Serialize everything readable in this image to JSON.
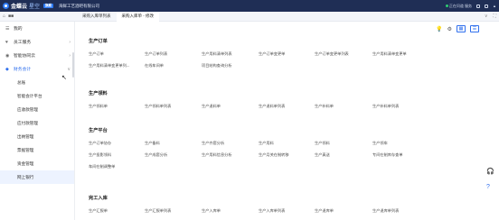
{
  "topbar": {
    "brand_main": "金蝶云",
    "brand_star": "星空",
    "badge": "旗舰",
    "company": "海鲜工艺酒吧有限公司",
    "right_status": "正在问道 服务",
    "right_extra": "▲"
  },
  "tabbar": {
    "icon_home": "⌂",
    "icon_grid": "■■",
    "tabs": [
      {
        "label": "采购入库单列表"
      },
      {
        "label": "采购入库单 - 修改"
      }
    ],
    "right_chevron": "∨",
    "right_expand": "⛶"
  },
  "sidebar": {
    "items": [
      {
        "label": "我的",
        "icon": "☰",
        "arrow": ""
      },
      {
        "label": "员工服务",
        "icon": "♥",
        "arrow": "›"
      },
      {
        "label": "智能协同云",
        "icon": "◉",
        "arrow": "›"
      },
      {
        "label": "财务会计",
        "icon": "◆",
        "arrow": "∨"
      }
    ],
    "sub_items": [
      {
        "label": "总账"
      },
      {
        "label": "智能会计平台"
      },
      {
        "label": "应收款管理"
      },
      {
        "label": "应付款管理"
      },
      {
        "label": "出纳管理"
      },
      {
        "label": "票据管理"
      },
      {
        "label": "资金管理"
      },
      {
        "label": "网上银行"
      }
    ]
  },
  "toolbar": {
    "icon_bulb": "💡",
    "icon_gear": "⚙",
    "icon_grid": "▦",
    "icon_list": "☰"
  },
  "sections": [
    {
      "title": "生产订单",
      "rows": [
        [
          "生产订单",
          "生产订单列表",
          "生产用料清单列表",
          "生产订单变更单",
          "生产订单变更单列表",
          "生产用料清单变更单"
        ],
        [
          "生产用料清单变更单列...",
          "在线车间单",
          "项目结构查询分析"
        ]
      ]
    },
    {
      "title": "生产领料",
      "rows": [
        [
          "生产领料单",
          "生产领料单列表",
          "生产退料单",
          "生产退料单列表",
          "生产补料单",
          "生产补料单列表"
        ]
      ]
    },
    {
      "title": "生产平台",
      "rows": [
        [
          "生产订单协办",
          "生产备料",
          "生产齐套分析",
          "生产用料",
          "生产领料",
          "生产领车"
        ],
        [
          "生产投影领料",
          "生产成套分析",
          "生产用料信息分析",
          "生产月关在制转移",
          "生产真送",
          "专间在制库存查单"
        ],
        [
          "车间在制调整单"
        ]
      ]
    },
    {
      "title": "完工入库",
      "rows": [
        [
          "生产汇报单",
          "生产汇报单列表",
          "生产入库单",
          "生产入库单列表",
          "生产退库单",
          "生产退库单列表"
        ]
      ]
    }
  ],
  "rail": {
    "icon_headset": "🎧",
    "icon_help": "?"
  }
}
